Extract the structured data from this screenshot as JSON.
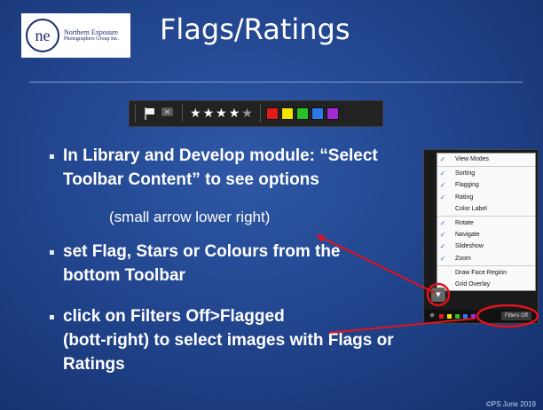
{
  "logo": {
    "name_line1": "Northern Exposure",
    "name_line2": "Photographers Group Inc."
  },
  "slide": {
    "title": "Flags/Ratings",
    "bullets": [
      {
        "lines": [
          "In Library and Develop module: “Select",
          "Toolbar Content” to see options"
        ]
      },
      {
        "lines": [
          "set Flag, Stars or Colours from the",
          "bottom Toolbar"
        ]
      },
      {
        "lines": [
          "click on Filters Off>Flagged",
          "(bott-right) to select images with Flags or",
          "Ratings"
        ]
      }
    ],
    "sub_note": "(small arrow lower right)",
    "copyright": "©PS June 2019"
  },
  "toolbar": {
    "stars_filled": 4,
    "stars_total": 5,
    "color_labels": [
      "#e01b1b",
      "#f2e600",
      "#27c22a",
      "#2b79e8",
      "#a22ad6"
    ]
  },
  "menu": {
    "items": [
      {
        "label": "View Modes",
        "checked": true
      },
      {
        "label": "Sorting",
        "checked": true
      },
      {
        "label": "Flagging",
        "checked": true
      },
      {
        "label": "Rating",
        "checked": true
      },
      {
        "label": "Color Label",
        "checked": false
      },
      {
        "label": "Rotate",
        "checked": true
      },
      {
        "label": "Navigate",
        "checked": true
      },
      {
        "label": "Slideshow",
        "checked": true
      },
      {
        "label": "Zoom",
        "checked": true
      },
      {
        "label": "Draw Face Region",
        "checked": false
      },
      {
        "label": "Grid Overlay",
        "checked": false
      }
    ],
    "filters_off_label": "Filters Off"
  },
  "colors": {
    "annotation": "#e3121b",
    "menu_check": "#2a6fd6"
  }
}
